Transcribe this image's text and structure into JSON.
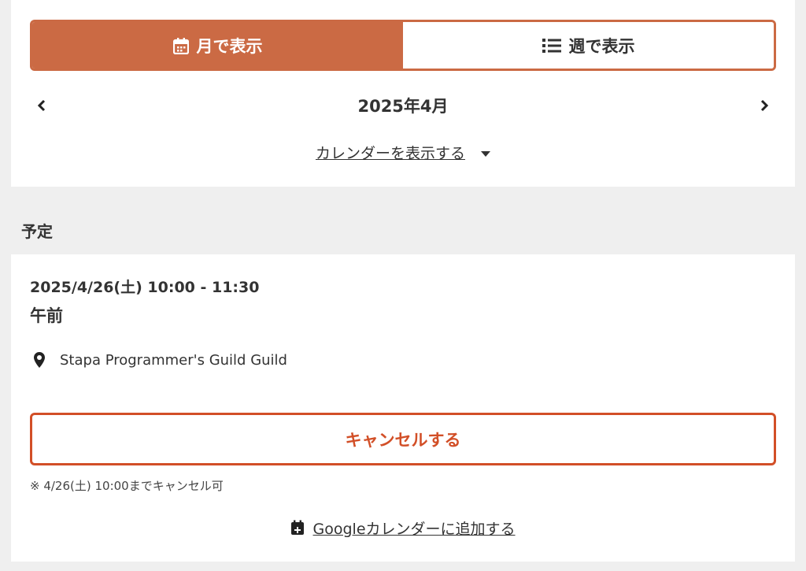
{
  "view_toggle": {
    "month_label": "月で表示",
    "week_label": "週で表示"
  },
  "month_nav": {
    "current": "2025年4月"
  },
  "calendar_toggle": {
    "label": "カレンダーを表示する"
  },
  "section": {
    "title": "予定"
  },
  "event": {
    "datetime": "2025/4/26(土) 10:00 - 11:30",
    "name": "午前",
    "location": "Stapa Programmer's Guild  Guild",
    "cancel_label": "キャンセルする",
    "cancel_note": "※ 4/26(土) 10:00までキャンセル可",
    "google_calendar_label": "Googleカレンダーに追加する"
  },
  "colors": {
    "accent": "#cb6a44",
    "cancel": "#d24f27",
    "background": "#efefef"
  },
  "icons": [
    "calendar-icon",
    "list-icon",
    "chevron-left-icon",
    "chevron-right-icon",
    "caret-down-icon",
    "map-pin-icon",
    "calendar-plus-icon"
  ]
}
